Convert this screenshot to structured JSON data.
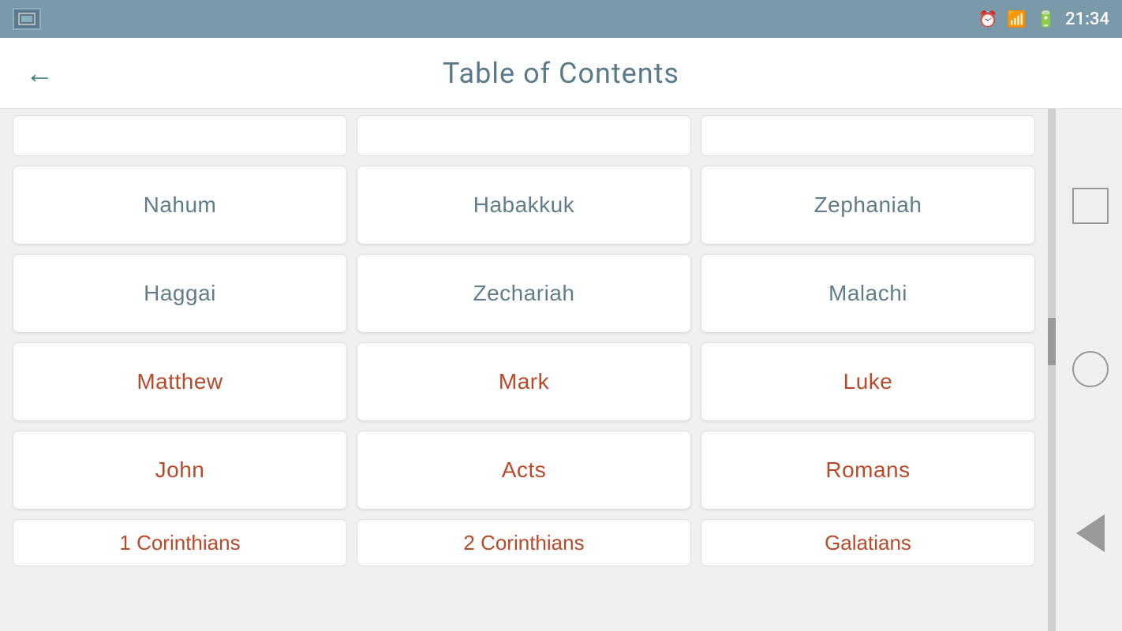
{
  "statusBar": {
    "time": "21:34"
  },
  "appBar": {
    "title": "Table of Contents",
    "backLabel": "←"
  },
  "grid": {
    "topPartial": [
      {
        "id": "partial-1",
        "label": ""
      },
      {
        "id": "partial-2",
        "label": ""
      },
      {
        "id": "partial-3",
        "label": ""
      }
    ],
    "rows": [
      [
        {
          "id": "nahum",
          "label": "Nahum",
          "type": "ot"
        },
        {
          "id": "habakkuk",
          "label": "Habakkuk",
          "type": "ot"
        },
        {
          "id": "zephaniah",
          "label": "Zephaniah",
          "type": "ot"
        }
      ],
      [
        {
          "id": "haggai",
          "label": "Haggai",
          "type": "ot"
        },
        {
          "id": "zechariah",
          "label": "Zechariah",
          "type": "ot"
        },
        {
          "id": "malachi",
          "label": "Malachi",
          "type": "ot"
        }
      ],
      [
        {
          "id": "matthew",
          "label": "Matthew",
          "type": "nt"
        },
        {
          "id": "mark",
          "label": "Mark",
          "type": "nt"
        },
        {
          "id": "luke",
          "label": "Luke",
          "type": "nt"
        }
      ],
      [
        {
          "id": "john",
          "label": "John",
          "type": "nt"
        },
        {
          "id": "acts",
          "label": "Acts",
          "type": "nt"
        },
        {
          "id": "romans",
          "label": "Romans",
          "type": "nt"
        }
      ],
      [
        {
          "id": "1corinthians",
          "label": "1 Corinthians",
          "type": "nt"
        },
        {
          "id": "2corinthians",
          "label": "2 Corinthians",
          "type": "nt"
        },
        {
          "id": "galatians",
          "label": "Galatians",
          "type": "nt"
        }
      ]
    ]
  }
}
